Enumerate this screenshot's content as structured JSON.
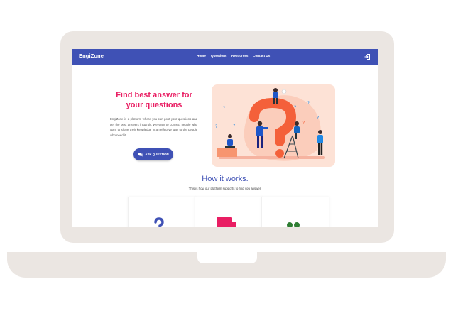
{
  "brand": "EngiZone",
  "nav": {
    "links": [
      "Home",
      "Questions",
      "Resources",
      "Contact Us"
    ],
    "login_icon": "login-icon"
  },
  "hero": {
    "title": "Find best answer for your questions",
    "description": "EngiZone is a platform where you can post your questions and get the best answers instantly. We want to connect people who want to share their knowledge in an effective way to the people who need it.",
    "ask_button": "ASK QUESTION",
    "ask_icon": "chat-bubble-icon"
  },
  "how": {
    "title": "How it works.",
    "subtitle": "This is how our platform supports to find you answer."
  },
  "cards": [
    {
      "icon": "question-mark-icon"
    },
    {
      "icon": "laptop-icon"
    },
    {
      "icon": "people-icon"
    }
  ],
  "colors": {
    "navbar": "#3f51b5",
    "accent_pink": "#e91e63",
    "laptop_frame": "#ebe6e2",
    "illustration_bg": "#fde2d6",
    "question_mark": "#f4603a",
    "people_green": "#2e7d32"
  }
}
